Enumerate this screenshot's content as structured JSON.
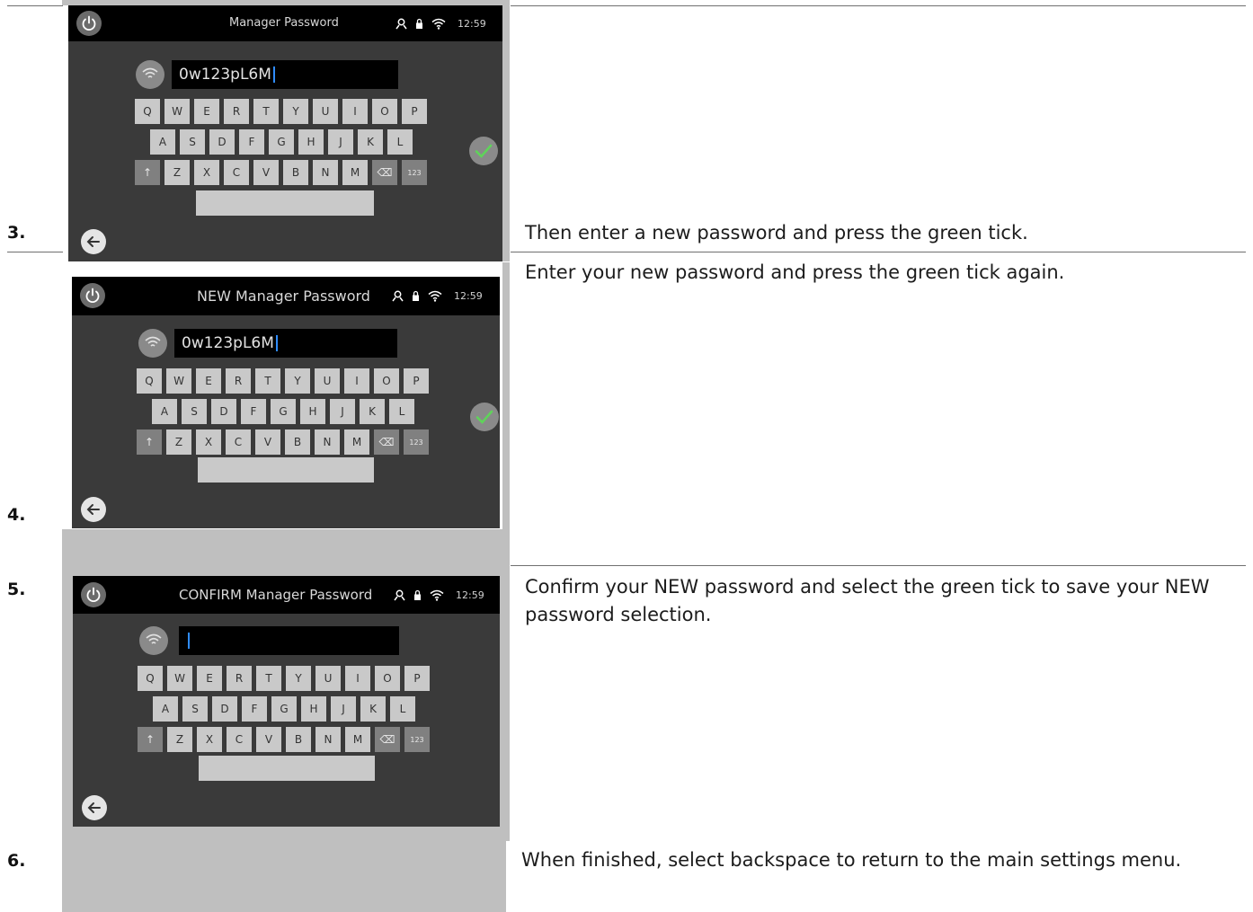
{
  "steps": [
    {
      "number": "3.",
      "description": "Then enter a new password and press the green tick.",
      "screen": {
        "title": "Manager Password",
        "time": "12:59",
        "password_value": "0w123pL6M",
        "keyboard_rows": [
          [
            "Q",
            "W",
            "E",
            "R",
            "T",
            "Y",
            "U",
            "I",
            "O",
            "P"
          ],
          [
            "A",
            "S",
            "D",
            "F",
            "G",
            "H",
            "J",
            "K",
            "L"
          ],
          [
            "↑",
            "Z",
            "X",
            "C",
            "V",
            "B",
            "N",
            "M",
            "⌫",
            "123"
          ]
        ]
      }
    },
    {
      "number": "4.",
      "description": "Enter your new password and press the green tick again.",
      "screen": {
        "title": "NEW Manager Password",
        "time": "12:59",
        "password_value": "0w123pL6M",
        "keyboard_rows": [
          [
            "Q",
            "W",
            "E",
            "R",
            "T",
            "Y",
            "U",
            "I",
            "O",
            "P"
          ],
          [
            "A",
            "S",
            "D",
            "F",
            "G",
            "H",
            "J",
            "K",
            "L"
          ],
          [
            "↑",
            "Z",
            "X",
            "C",
            "V",
            "B",
            "N",
            "M",
            "⌫",
            "123"
          ]
        ]
      }
    },
    {
      "number": "5.",
      "description": "Confirm your NEW password and select the green tick to save your NEW password selection.",
      "screen": {
        "title": "CONFIRM Manager Password",
        "time": "12:59",
        "password_value": "",
        "keyboard_rows": [
          [
            "Q",
            "W",
            "E",
            "R",
            "T",
            "Y",
            "U",
            "I",
            "O",
            "P"
          ],
          [
            "A",
            "S",
            "D",
            "F",
            "G",
            "H",
            "J",
            "K",
            "L"
          ],
          [
            "↑",
            "Z",
            "X",
            "C",
            "V",
            "B",
            "N",
            "M",
            "⌫",
            "123"
          ]
        ]
      }
    },
    {
      "number": "6.",
      "description": "When finished, select backspace to return to the main settings menu."
    }
  ],
  "icons": {
    "power": "power-icon",
    "wifi": "wifi-icon",
    "user": "user-icon",
    "lock": "lock-icon",
    "tick": "checkmark-icon",
    "back": "arrow-left-icon"
  },
  "colors": {
    "screen_bg": "#3a3a3a",
    "topbar": "#000000",
    "key": "#c9c9c9",
    "tick_green": "#5fd35a",
    "caret_blue": "#2f8cff"
  }
}
